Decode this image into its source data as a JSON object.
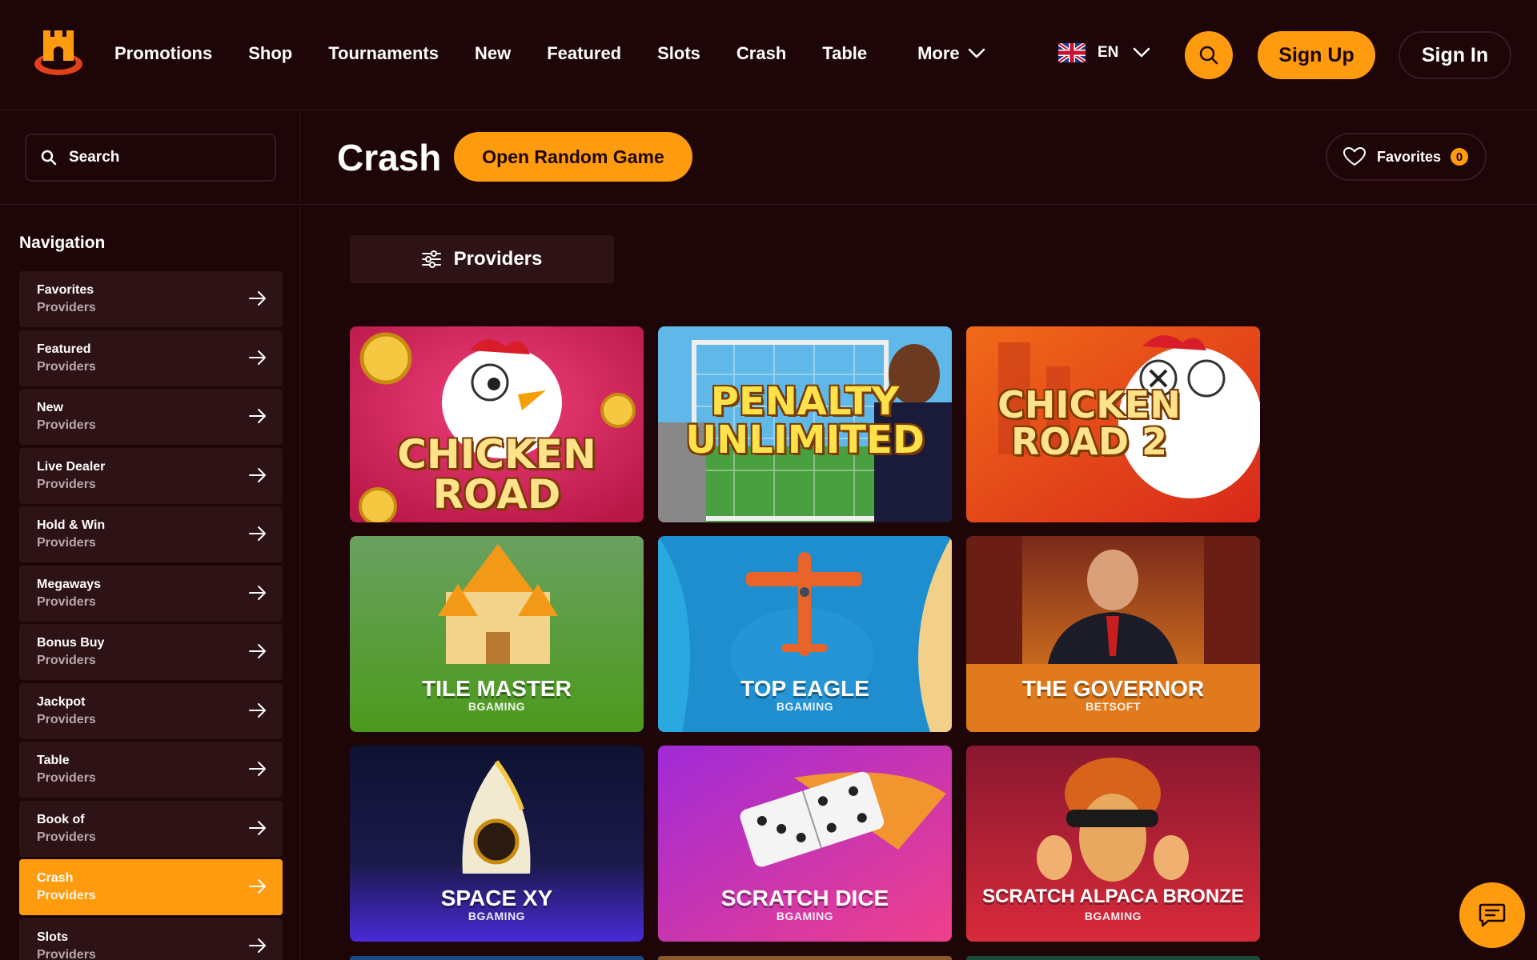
{
  "header": {
    "nav": [
      "Promotions",
      "Shop",
      "Tournaments",
      "New",
      "Featured",
      "Slots",
      "Crash",
      "Table"
    ],
    "more_label": "More",
    "language": "EN",
    "sign_up": "Sign Up",
    "sign_in": "Sign In"
  },
  "sidebar": {
    "search_placeholder": "Search",
    "heading": "Navigation",
    "items": [
      {
        "label": "Favorites",
        "sub": "Providers",
        "active": false
      },
      {
        "label": "Featured",
        "sub": "Providers",
        "active": false
      },
      {
        "label": "New",
        "sub": "Providers",
        "active": false
      },
      {
        "label": "Live Dealer",
        "sub": "Providers",
        "active": false
      },
      {
        "label": "Hold & Win",
        "sub": "Providers",
        "active": false
      },
      {
        "label": "Megaways",
        "sub": "Providers",
        "active": false
      },
      {
        "label": "Bonus Buy",
        "sub": "Providers",
        "active": false
      },
      {
        "label": "Jackpot",
        "sub": "Providers",
        "active": false
      },
      {
        "label": "Table",
        "sub": "Providers",
        "active": false
      },
      {
        "label": "Book of",
        "sub": "Providers",
        "active": false
      },
      {
        "label": "Crash",
        "sub": "Providers",
        "active": true
      },
      {
        "label": "Slots",
        "sub": "Providers",
        "active": false
      }
    ]
  },
  "main": {
    "title": "Crash",
    "random_button": "Open Random Game",
    "favorites_label": "Favorites",
    "favorites_count": "0",
    "providers_button": "Providers",
    "games": [
      {
        "title": "CHICKEN ROAD",
        "provider": ""
      },
      {
        "title": "PENALTY UNLIMITED",
        "provider": ""
      },
      {
        "title": "CHICKEN ROAD 2",
        "provider": ""
      },
      {
        "title": "TILE MASTER",
        "provider": "BGAMING"
      },
      {
        "title": "TOP EAGLE",
        "provider": "BGAMING"
      },
      {
        "title": "THE GOVERNOR",
        "provider": "BETSOFT"
      },
      {
        "title": "SPACE XY",
        "provider": "BGAMING"
      },
      {
        "title": "SCRATCH DICE",
        "provider": "BGAMING"
      },
      {
        "title": "SCRATCH ALPACA BRONZE",
        "provider": "BGAMING"
      }
    ]
  },
  "colors": {
    "background": "#1e0508",
    "accent": "#ff9b0f",
    "panel": "#2e1316"
  },
  "icons": [
    "logo-castle-icon",
    "chevron-down-icon",
    "uk-flag-icon",
    "search-icon",
    "arrow-right-icon",
    "heart-icon",
    "filter-sliders-icon",
    "chat-icon"
  ]
}
